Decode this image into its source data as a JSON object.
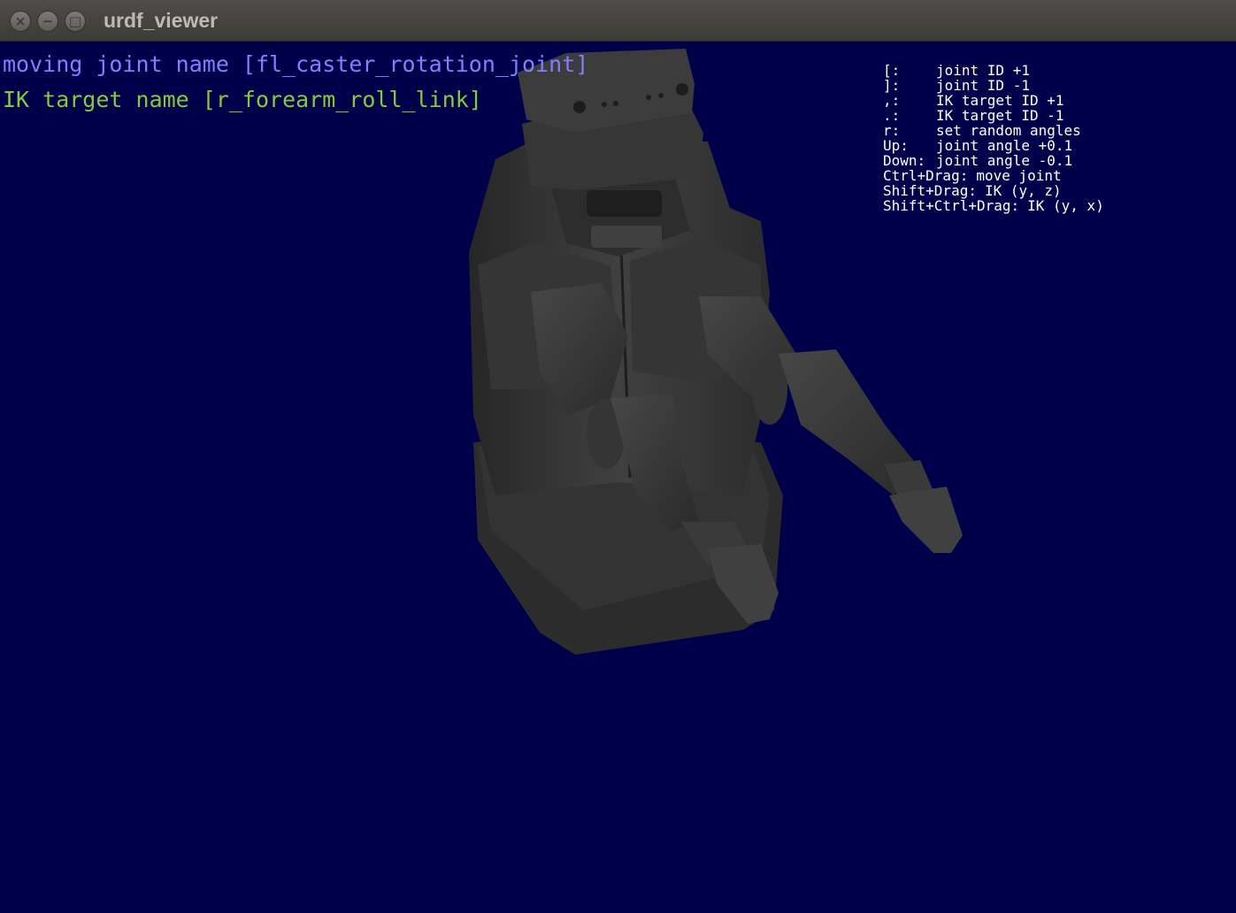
{
  "window": {
    "title": "urdf_viewer",
    "controls": {
      "close": "×",
      "minimize": "−",
      "maximize": "□"
    }
  },
  "overlay": {
    "moving_joint": "moving joint name [fl_caster_rotation_joint]",
    "ik_target": "IK target name [r_forearm_roll_link]",
    "moving_joint_color": "#8080ff",
    "ik_target_color": "#80cc40"
  },
  "help": [
    {
      "key": "[:",
      "desc": "joint ID +1"
    },
    {
      "key": "]:",
      "desc": "joint ID -1"
    },
    {
      "key": ",:",
      "desc": "IK target ID +1"
    },
    {
      "key": ".:",
      "desc": "IK target ID -1"
    },
    {
      "key": "r:",
      "desc": "set random angles"
    },
    {
      "key": "Up:",
      "desc": "joint angle +0.1"
    },
    {
      "key": "Down:",
      "desc": "joint angle -0.1"
    },
    {
      "key": "Ctrl+Drag:",
      "desc": "move joint"
    },
    {
      "key": "Shift+Drag:",
      "desc": "IK (y, z)"
    },
    {
      "key": "Shift+Ctrl+Drag:",
      "desc": "IK (y, x)"
    }
  ],
  "scene": {
    "background_color": "#00004a",
    "robot_color": "#3a3a3a",
    "object": "robot-model"
  }
}
